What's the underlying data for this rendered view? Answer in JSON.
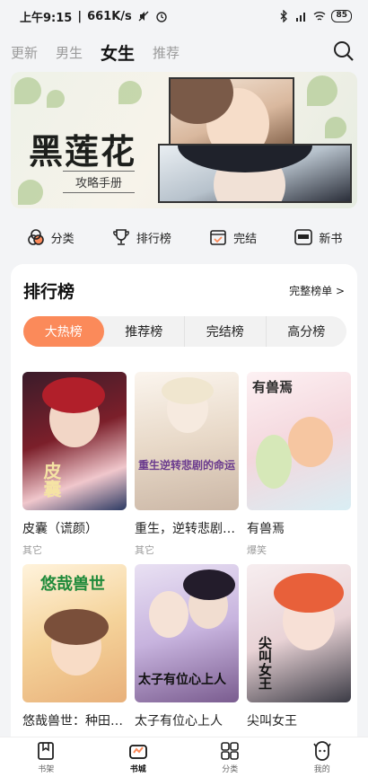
{
  "status": {
    "time": "上午9:15",
    "speed": "661K/s",
    "battery": "85"
  },
  "top_tabs": [
    {
      "label": "更新"
    },
    {
      "label": "男生"
    },
    {
      "label": "女生"
    },
    {
      "label": "推荐"
    }
  ],
  "banner": {
    "title": "黑莲花",
    "subtitle": "攻略手册"
  },
  "categories": [
    {
      "label": "分类",
      "icon": "category-icon"
    },
    {
      "label": "排行榜",
      "icon": "trophy-icon"
    },
    {
      "label": "完结",
      "icon": "finished-icon"
    },
    {
      "label": "新书",
      "icon": "new-book-icon"
    }
  ],
  "ranking": {
    "title": "排行榜",
    "more": "完整榜单 >",
    "tabs": [
      {
        "label": "大热榜"
      },
      {
        "label": "推荐榜"
      },
      {
        "label": "完结榜"
      },
      {
        "label": "高分榜"
      }
    ],
    "books": [
      {
        "title": "皮囊（谎颜）",
        "tag": "其它",
        "cover_text": "皮囊"
      },
      {
        "title": "重生，逆转悲剧的命运",
        "tag": "其它",
        "cover_text": "重生逆转悲剧的命运"
      },
      {
        "title": "有兽焉",
        "tag": "爆笑",
        "cover_text": "有兽焉"
      },
      {
        "title": "悠哉兽世：种田生崽",
        "tag": "",
        "cover_text": "悠哉兽世"
      },
      {
        "title": "太子有位心上人",
        "tag": "",
        "cover_text": "太子有位心上人"
      },
      {
        "title": "尖叫女王",
        "tag": "",
        "cover_text": "尖叫女王"
      }
    ]
  },
  "bottom_nav": [
    {
      "label": "书架"
    },
    {
      "label": "书城"
    },
    {
      "label": "分类"
    },
    {
      "label": "我的"
    }
  ],
  "colors": {
    "accent": "#fb8a5a",
    "bg": "#f3f4f6"
  }
}
